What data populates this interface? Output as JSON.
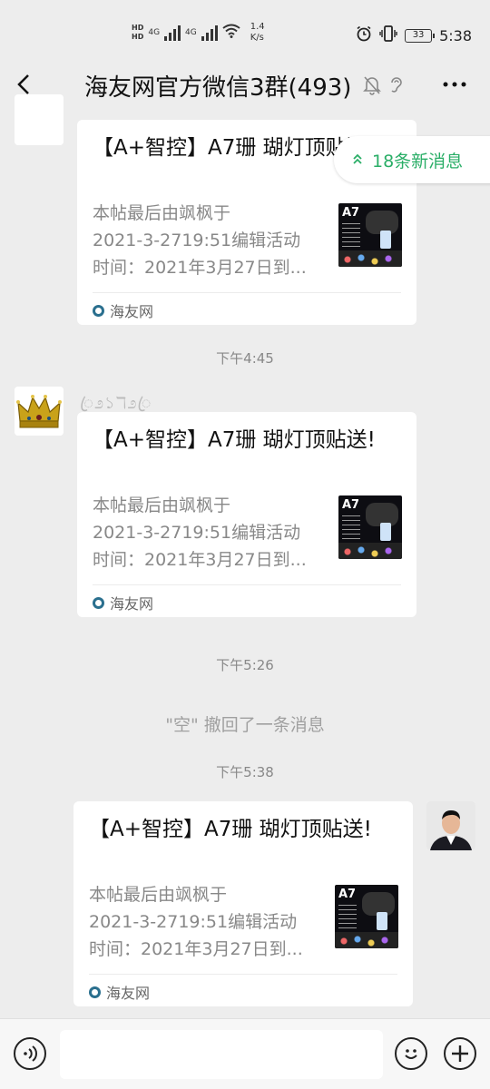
{
  "status_bar": {
    "hd1": "HD",
    "hd2": "HD",
    "net1": "4G",
    "net2": "4G",
    "speed_value": "1.4",
    "speed_unit": "K/s",
    "battery": "33",
    "time": "5:38"
  },
  "header": {
    "title": "海友网官方微信3群(493)",
    "back_icon": "chevron-left-icon",
    "more_icon": "more-dots-icon"
  },
  "new_messages": {
    "label": "18条新消息"
  },
  "timestamps": [
    "下午4:45",
    "下午5:26",
    "下午5:38"
  ],
  "recall_notice": "\"空\" 撤回了一条消息",
  "sender_nickname": "ꦿ೨১ℸ೨ꦿ",
  "messages": [
    {
      "title": "【A+智控】A7珊 瑚灯顶贴送!",
      "desc_line1": "本帖最后由飒枫于",
      "desc_line2": "2021-3-2719:51编辑活动",
      "desc_line3": "时间：2021年3月27日到...",
      "thumb_label": "A7",
      "source": "海友网"
    },
    {
      "title": "【A+智控】A7珊 瑚灯顶贴送!",
      "desc_line1": "本帖最后由飒枫于",
      "desc_line2": "2021-3-2719:51编辑活动",
      "desc_line3": "时间：2021年3月27日到...",
      "thumb_label": "A7",
      "source": "海友网"
    },
    {
      "title": "【A+智控】A7珊 瑚灯顶贴送!",
      "desc_line1": "本帖最后由飒枫于",
      "desc_line2": "2021-3-2719:51编辑活动",
      "desc_line3": "时间：2021年3月27日到...",
      "thumb_label": "A7",
      "source": "海友网"
    }
  ],
  "input": {
    "placeholder": ""
  }
}
